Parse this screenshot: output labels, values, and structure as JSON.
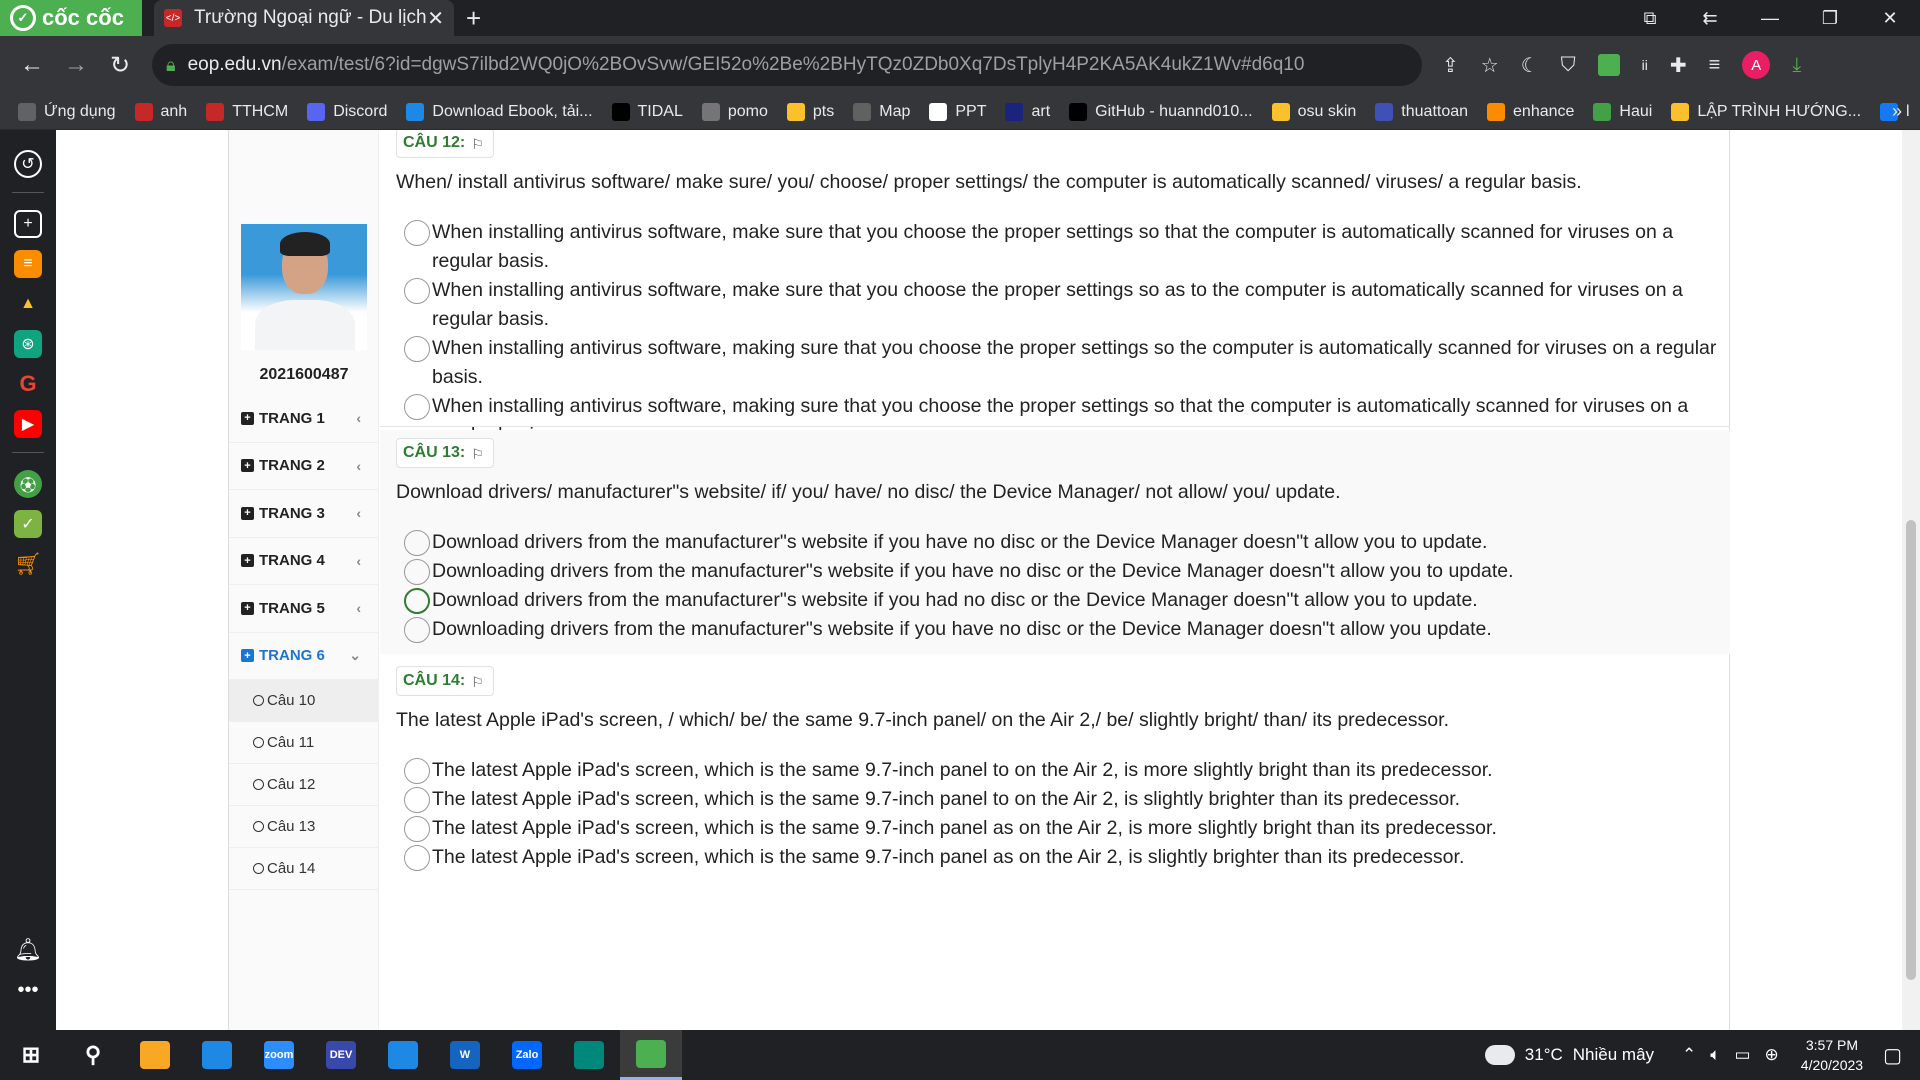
{
  "browser": {
    "brand": "cốc cốc",
    "tab_title": "Trường Ngoại ngữ - Du lịch",
    "url_host": "eop.edu.vn",
    "url_path": "/exam/test/6?id=dgwS7ilbd2WQ0jO%2BOvSvw/GEI52o%2Be%2BHyTQz0ZDb0Xq7DsTplyH4P2KA5AK4ukZ1Wv#d6q10",
    "profile_initial": "A",
    "extension_label": "ii"
  },
  "bookmarks": [
    {
      "label": "Ứng dụng",
      "color": "#5f6368",
      "icon": "apps-icon"
    },
    {
      "label": "anh",
      "color": "#c62828",
      "icon": "code-icon"
    },
    {
      "label": "TTHCM",
      "color": "#c62828",
      "icon": "code-icon"
    },
    {
      "label": "Discord",
      "color": "#5865f2",
      "icon": "discord-icon"
    },
    {
      "label": "Download Ebook, tải...",
      "color": "#1e88e5",
      "icon": "globe-icon"
    },
    {
      "label": "TIDAL",
      "color": "#000000",
      "icon": "tidal-icon"
    },
    {
      "label": "pomo",
      "color": "#757575",
      "icon": "check-icon"
    },
    {
      "label": "pts",
      "color": "#fbc02d",
      "icon": "drive-icon"
    },
    {
      "label": "Map",
      "color": "#616161",
      "icon": "globe-icon"
    },
    {
      "label": "PPT",
      "color": "#ffffff",
      "icon": "ppt-icon"
    },
    {
      "label": "art",
      "color": "#1a237e",
      "icon": "art-icon"
    },
    {
      "label": "GitHub - huannd010...",
      "color": "#000000",
      "icon": "github-icon"
    },
    {
      "label": "osu skin",
      "color": "#fbc02d",
      "icon": "drive-icon"
    },
    {
      "label": "thuattoan",
      "color": "#3f51b5",
      "icon": "globe-icon"
    },
    {
      "label": "enhance",
      "color": "#fb8c00",
      "icon": "enhance-icon"
    },
    {
      "label": "Haui",
      "color": "#43a047",
      "icon": "haui-icon"
    },
    {
      "label": "LẬP TRÌNH HƯỚNG...",
      "color": "#fbc02d",
      "icon": "drive-icon"
    },
    {
      "label": "l",
      "color": "#1877f2",
      "icon": "facebook-icon"
    }
  ],
  "sidebar": {
    "student_id": "2021600487",
    "pages": [
      {
        "label": "TRANG 1",
        "chevron": "‹"
      },
      {
        "label": "TRANG 2",
        "chevron": "‹"
      },
      {
        "label": "TRANG 3",
        "chevron": "‹"
      },
      {
        "label": "TRANG 4",
        "chevron": "‹"
      },
      {
        "label": "TRANG 5",
        "chevron": "‹"
      },
      {
        "label": "TRANG 6",
        "chevron": "⌄"
      }
    ],
    "questions": [
      "Câu 10",
      "Câu 11",
      "Câu 12",
      "Câu 13",
      "Câu 14"
    ]
  },
  "questions": [
    {
      "label": "CÂU 12:",
      "prompt": "When/ install antivirus software/ make sure/ you/ choose/ proper settings/ the computer is automatically scanned/ viruses/ a regular basis.",
      "options": [
        "When installing antivirus software, make sure that you choose the proper settings so that the computer is automatically scanned for viruses on a regular basis.",
        "When installing antivirus software, make sure that you choose the proper settings so as to the computer is automatically scanned for viruses on a regular basis.",
        "When installing antivirus software, making sure that you choose the proper settings so the computer is automatically scanned for viruses on a regular basis.",
        "When installing antivirus software, making sure that you choose the proper settings so that the computer is automatically scanned for viruses on a regular basis."
      ],
      "selected": -1
    },
    {
      "label": "CÂU 13:",
      "prompt": "Download drivers/ manufacturer\"s website/ if/ you/ have/ no disc/ the Device Manager/ not allow/ you/ update.",
      "options": [
        "Download drivers from the manufacturer\"s website if you have no disc or the Device Manager doesn\"t allow you to update.",
        "Downloading drivers from the manufacturer\"s website if you have no disc or the Device Manager doesn\"t allow you to update.",
        "Download drivers from the manufacturer\"s website if you had no disc or the Device Manager doesn\"t allow you to update.",
        "Downloading drivers from the manufacturer\"s website if you have no disc or the Device Manager doesn\"t allow you update."
      ],
      "selected": 2
    },
    {
      "label": "CÂU 14:",
      "prompt": "The latest Apple iPad's screen, / which/ be/ the same 9.7-inch panel/ on the Air 2,/ be/ slightly bright/ than/ its predecessor.",
      "options": [
        "The latest Apple iPad's screen, which is the same 9.7-inch panel to on the Air 2, is more slightly bright than its predecessor.",
        "The latest Apple iPad's screen, which is the same 9.7-inch panel to on the Air 2, is slightly brighter than its predecessor.",
        "The latest Apple iPad's screen, which is the same 9.7-inch panel as on the Air 2, is more slightly bright than its predecessor.",
        "The latest Apple iPad's screen, which is the same 9.7-inch panel as on the Air 2, is slightly brighter than its predecessor."
      ],
      "selected": -1
    }
  ],
  "taskbar": {
    "apps": [
      {
        "name": "start-icon",
        "label": "⊞",
        "color": "#202124"
      },
      {
        "name": "search-icon",
        "label": "⚲",
        "color": "#202124"
      },
      {
        "name": "file-explorer-icon",
        "label": "",
        "color": "#f9a825"
      },
      {
        "name": "safari-icon",
        "label": "",
        "color": "#1e88e5"
      },
      {
        "name": "zoom-icon",
        "label": "zoom",
        "color": "#2d8cff"
      },
      {
        "name": "devc-icon",
        "label": "DEV",
        "color": "#3949ab"
      },
      {
        "name": "vscode-icon",
        "label": "",
        "color": "#1e88e5"
      },
      {
        "name": "word-icon",
        "label": "W",
        "color": "#1565c0"
      },
      {
        "name": "zalo-icon",
        "label": "Zalo",
        "color": "#0068ff"
      },
      {
        "name": "edge-dev-icon",
        "label": "",
        "color": "#00897b"
      },
      {
        "name": "coccoc-icon",
        "label": "",
        "color": "#4caf50"
      }
    ],
    "weather_temp": "31°C",
    "weather_desc": "Nhiều mây",
    "time": "3:57 PM",
    "date": "4/20/2023"
  }
}
